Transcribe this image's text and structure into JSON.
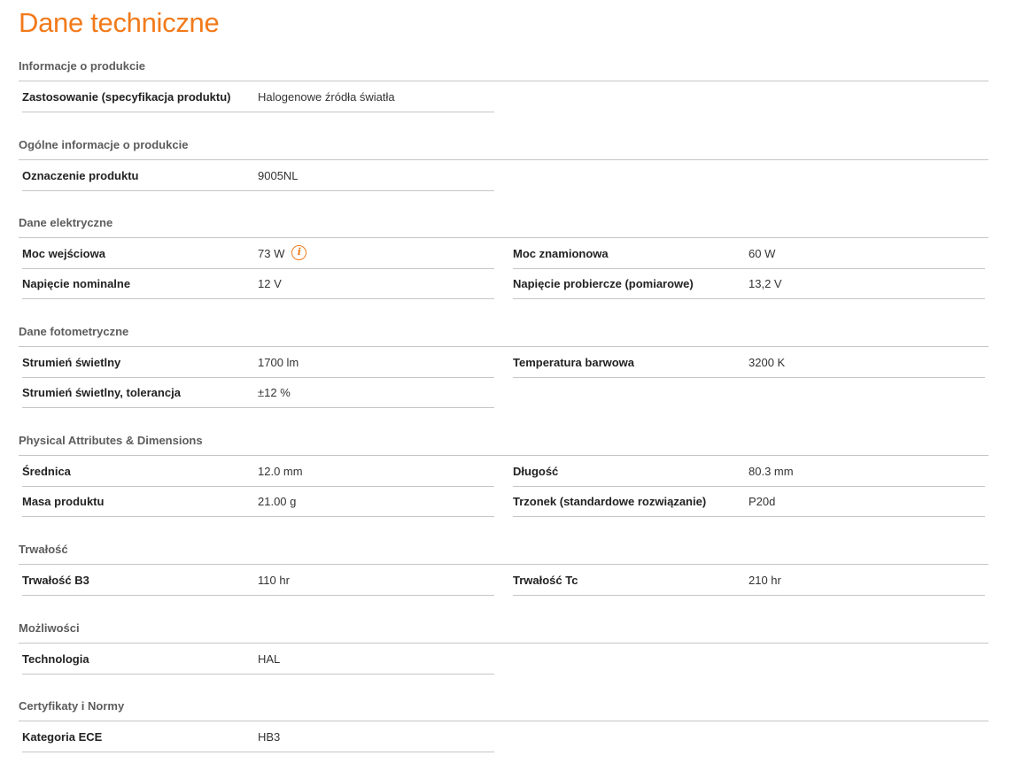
{
  "page_title": "Dane techniczne",
  "sections": [
    {
      "title": "Informacje o produkcie",
      "rows": [
        [
          {
            "label": "Zastosowanie (specyfikacja produktu)",
            "value": "Halogenowe źródła światła"
          }
        ]
      ]
    },
    {
      "title": "Ogólne informacje o produkcie",
      "rows": [
        [
          {
            "label": "Oznaczenie produktu",
            "value": "9005NL"
          }
        ]
      ]
    },
    {
      "title": "Dane elektryczne",
      "rows": [
        [
          {
            "label": "Moc wejściowa",
            "value": "73 W",
            "info_icon": "info-icon"
          },
          {
            "label": "Moc znamionowa",
            "value": "60 W"
          }
        ],
        [
          {
            "label": "Napięcie nominalne",
            "value": "12 V"
          },
          {
            "label": "Napięcie probiercze (pomiarowe)",
            "value": "13,2 V"
          }
        ]
      ]
    },
    {
      "title": "Dane fotometryczne",
      "rows": [
        [
          {
            "label": "Strumień świetlny",
            "value": "1700 lm"
          },
          {
            "label": "Temperatura barwowa",
            "value": "3200 K"
          }
        ],
        [
          {
            "label": "Strumień świetlny, tolerancja",
            "value": "±12 %"
          }
        ]
      ]
    },
    {
      "title": "Physical Attributes & Dimensions",
      "rows": [
        [
          {
            "label": "Średnica",
            "value": "12.0 mm"
          },
          {
            "label": "Długość",
            "value": "80.3 mm"
          }
        ],
        [
          {
            "label": "Masa produktu",
            "value": "21.00 g"
          },
          {
            "label": "Trzonek (standardowe rozwiązanie)",
            "value": "P20d"
          }
        ]
      ]
    },
    {
      "title": "Trwałość",
      "rows": [
        [
          {
            "label": "Trwałość B3",
            "value": "110 hr"
          },
          {
            "label": "Trwałość Tc",
            "value": "210 hr"
          }
        ]
      ]
    },
    {
      "title": "Możliwości",
      "rows": [
        [
          {
            "label": "Technologia",
            "value": "HAL"
          }
        ]
      ]
    },
    {
      "title": "Certyfikaty i Normy",
      "rows": [
        [
          {
            "label": "Kategoria ECE",
            "value": "HB3"
          }
        ]
      ]
    }
  ],
  "colors": {
    "accent": "#f27a1a",
    "rule": "#c6c6c6",
    "section_title": "#5c5c5c"
  }
}
